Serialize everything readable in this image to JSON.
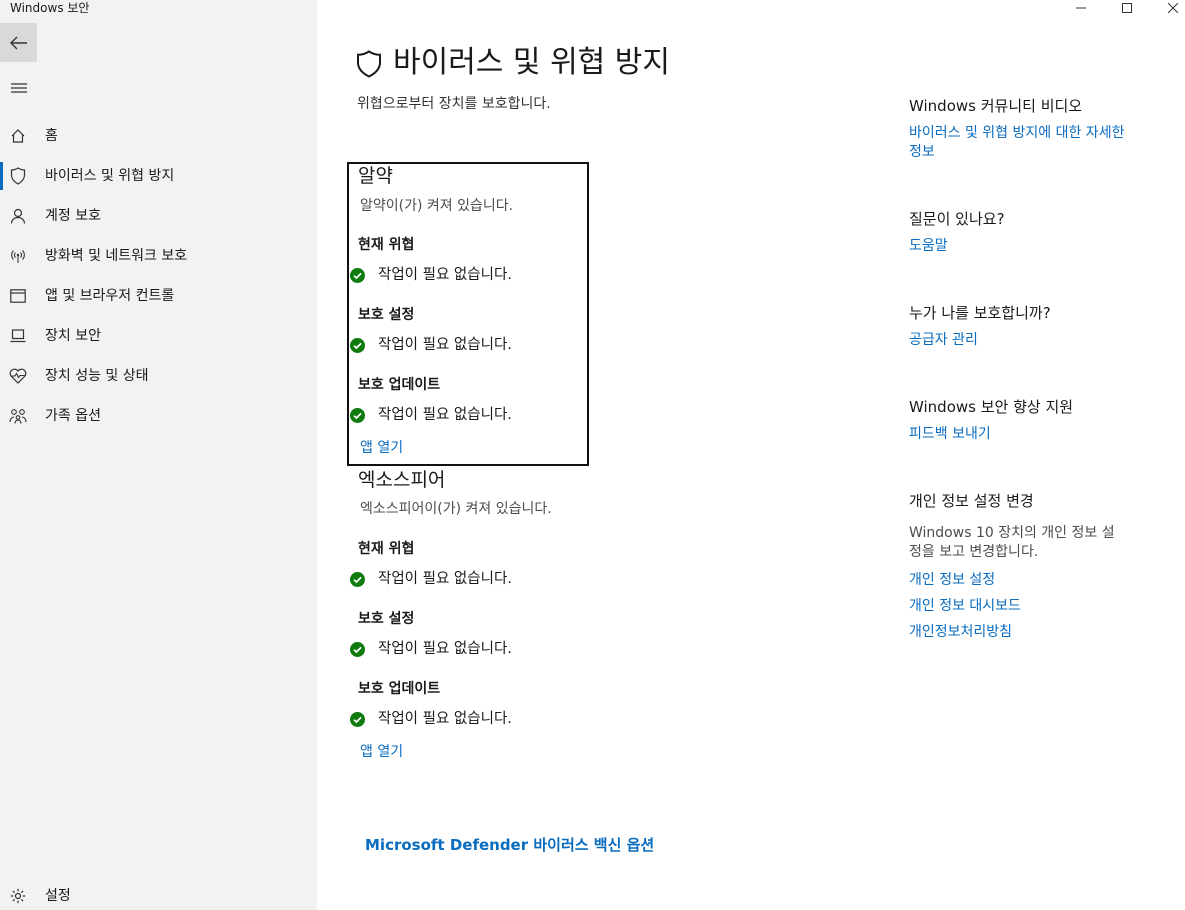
{
  "window": {
    "title": "Windows 보안"
  },
  "sidebar": {
    "items": [
      {
        "label": "홈",
        "icon": "home-icon"
      },
      {
        "label": "바이러스 및 위협 방지",
        "icon": "shield-icon",
        "active": true
      },
      {
        "label": "계정 보호",
        "icon": "person-icon"
      },
      {
        "label": "방화벽 및 네트워크 보호",
        "icon": "wifi-signal-icon"
      },
      {
        "label": "앱 및 브라우저 컨트롤",
        "icon": "browser-window-icon"
      },
      {
        "label": "장치 보안",
        "icon": "laptop-icon"
      },
      {
        "label": "장치 성능 및 상태",
        "icon": "heart-pulse-icon"
      },
      {
        "label": "가족 옵션",
        "icon": "family-icon"
      }
    ],
    "settings_label": "설정"
  },
  "main": {
    "title": "바이러스 및 위협 방지",
    "subtitle": "위협으로부터 장치를 보호합니다.",
    "providers": [
      {
        "name": "알약",
        "status": "알약이(가) 켜져 있습니다.",
        "sections": [
          {
            "heading": "현재 위협",
            "status": "작업이 필요 없습니다."
          },
          {
            "heading": "보호 설정",
            "status": "작업이 필요 없습니다."
          },
          {
            "heading": "보호 업데이트",
            "status": "작업이 필요 없습니다."
          }
        ],
        "open_app": "앱 열기"
      },
      {
        "name": "엑소스피어",
        "status": "엑소스피어이(가) 켜져 있습니다.",
        "sections": [
          {
            "heading": "현재 위협",
            "status": "작업이 필요 없습니다."
          },
          {
            "heading": "보호 설정",
            "status": "작업이 필요 없습니다."
          },
          {
            "heading": "보호 업데이트",
            "status": "작업이 필요 없습니다."
          }
        ],
        "open_app": "앱 열기"
      }
    ],
    "defender_link": "Microsoft Defender 바이러스 백신 옵션"
  },
  "right_panel": {
    "community_heading": "Windows 커뮤니티 비디오",
    "community_link_line1": "바이러스 및 위협 방지에 대한 자세한",
    "community_link_line2": "정보",
    "question_heading": "질문이 있나요?",
    "help_link": "도움말",
    "protector_heading": "누가 나를 보호합니까?",
    "provider_link": "공급자 관리",
    "improve_heading": "Windows 보안 향상 지원",
    "feedback_link": "피드백 보내기",
    "privacy_heading": "개인 정보 설정 변경",
    "privacy_text_line1": "Windows 10 장치의 개인 정보 설",
    "privacy_text_line2": "정을 보고 변경합니다.",
    "privacy_settings_link": "개인 정보 설정",
    "privacy_dashboard_link": "개인 정보 대시보드",
    "privacy_policy_link": "개인정보처리방침"
  },
  "colors": {
    "accent": "#0a6cbf",
    "ok_green": "#0f7b0f",
    "sidebar_bg": "#f2f2f2"
  }
}
